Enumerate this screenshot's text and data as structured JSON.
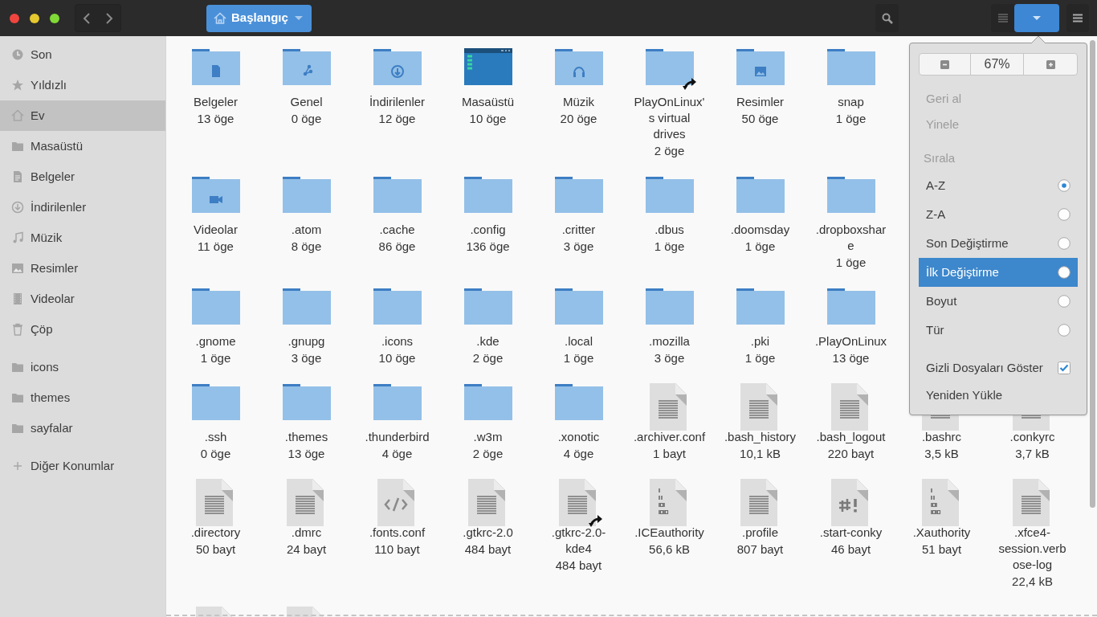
{
  "header": {
    "location": "Başlangıç"
  },
  "sidebar": {
    "sections": [
      [
        {
          "label": "Son",
          "kind": "clock",
          "selected": false
        },
        {
          "label": "Yıldızlı",
          "kind": "star",
          "selected": false
        },
        {
          "label": "Ev",
          "kind": "home",
          "selected": true
        },
        {
          "label": "Masaüstü",
          "kind": "folder",
          "selected": false
        },
        {
          "label": "Belgeler",
          "kind": "doc",
          "selected": false
        },
        {
          "label": "İndirilenler",
          "kind": "download",
          "selected": false
        },
        {
          "label": "Müzik",
          "kind": "music",
          "selected": false
        },
        {
          "label": "Resimler",
          "kind": "image",
          "selected": false
        },
        {
          "label": "Videolar",
          "kind": "video",
          "selected": false
        },
        {
          "label": "Çöp",
          "kind": "trash",
          "selected": false
        }
      ],
      [
        {
          "label": "icons",
          "kind": "folder",
          "selected": false
        },
        {
          "label": "themes",
          "kind": "folder",
          "selected": false
        },
        {
          "label": "sayfalar",
          "kind": "folder",
          "selected": false
        }
      ],
      [
        {
          "label": "Diğer Konumlar",
          "kind": "plus",
          "selected": false
        }
      ]
    ]
  },
  "files": {
    "rows": [
      [
        {
          "name": "Belgeler",
          "info": "13 öge",
          "kind": "folder-doc",
          "link": false
        },
        {
          "name": "Genel",
          "info": "0 öge",
          "kind": "folder-share",
          "link": false
        },
        {
          "name": "İndirilenler",
          "info": "12 öge",
          "kind": "folder-download",
          "link": false
        },
        {
          "name": "Masaüstü",
          "info": "10 öge",
          "kind": "desktop",
          "link": false
        },
        {
          "name": "Müzik",
          "info": "20 öge",
          "kind": "folder-music",
          "link": false
        },
        {
          "name": "PlayOnLinux's virtual drives",
          "info": "2 öge",
          "kind": "folder",
          "link": true
        },
        {
          "name": "Resimler",
          "info": "50 öge",
          "kind": "folder-image",
          "link": false
        },
        {
          "name": "snap",
          "info": "1 öge",
          "kind": "folder",
          "link": false
        }
      ],
      [
        {
          "name": "Videolar",
          "info": "11 öge",
          "kind": "folder-video",
          "link": false
        },
        {
          "name": ".atom",
          "info": "8 öge",
          "kind": "folder",
          "link": false
        },
        {
          "name": ".cache",
          "info": "86 öge",
          "kind": "folder",
          "link": false
        },
        {
          "name": ".config",
          "info": "136 öge",
          "kind": "folder",
          "link": false
        },
        {
          "name": ".critter",
          "info": "3 öge",
          "kind": "folder",
          "link": false
        },
        {
          "name": ".dbus",
          "info": "1 öge",
          "kind": "folder",
          "link": false
        },
        {
          "name": ".doomsday",
          "info": "1 öge",
          "kind": "folder",
          "link": false
        },
        {
          "name": ".dropboxshare",
          "info": "1 öge",
          "kind": "folder",
          "link": false
        }
      ],
      [
        {
          "name": ".gnome",
          "info": "1 öge",
          "kind": "folder",
          "link": false
        },
        {
          "name": ".gnupg",
          "info": "3 öge",
          "kind": "folder",
          "link": false
        },
        {
          "name": ".icons",
          "info": "10 öge",
          "kind": "folder",
          "link": false
        },
        {
          "name": ".kde",
          "info": "2 öge",
          "kind": "folder",
          "link": false
        },
        {
          "name": ".local",
          "info": "1 öge",
          "kind": "folder",
          "link": false
        },
        {
          "name": ".mozilla",
          "info": "3 öge",
          "kind": "folder",
          "link": false
        },
        {
          "name": ".pki",
          "info": "1 öge",
          "kind": "folder",
          "link": false
        },
        {
          "name": ".PlayOnLinux",
          "info": "13 öge",
          "kind": "folder",
          "link": false
        }
      ],
      [
        {
          "name": ".ssh",
          "info": "0 öge",
          "kind": "folder",
          "link": false
        },
        {
          "name": ".themes",
          "info": "13 öge",
          "kind": "folder",
          "link": false
        },
        {
          "name": ".thunderbird",
          "info": "4 öge",
          "kind": "folder",
          "link": false
        },
        {
          "name": ".w3m",
          "info": "2 öge",
          "kind": "folder",
          "link": false
        },
        {
          "name": ".xonotic",
          "info": "4 öge",
          "kind": "folder",
          "link": false
        },
        {
          "name": ".archiver.conf",
          "info": "1 bayt",
          "kind": "text",
          "link": false
        },
        {
          "name": ".bash_history",
          "info": "10,1 kB",
          "kind": "text",
          "link": false
        },
        {
          "name": ".bash_logout",
          "info": "220 bayt",
          "kind": "text",
          "link": false
        },
        {
          "name": ".bashrc",
          "info": "3,5 kB",
          "kind": "text",
          "link": false
        },
        {
          "name": ".conkyrc",
          "info": "3,7 kB",
          "kind": "text",
          "link": false
        }
      ],
      [
        {
          "name": ".directory",
          "info": "50 bayt",
          "kind": "text",
          "link": false
        },
        {
          "name": ".dmrc",
          "info": "24 bayt",
          "kind": "text",
          "link": false
        },
        {
          "name": ".fonts.conf",
          "info": "110 bayt",
          "kind": "code",
          "link": false
        },
        {
          "name": ".gtkrc-2.0",
          "info": "484 bayt",
          "kind": "text",
          "link": false
        },
        {
          "name": ".gtkrc-2.0-kde4",
          "info": "484 bayt",
          "kind": "text",
          "link": true
        },
        {
          "name": ".ICEauthority",
          "info": "56,6 kB",
          "kind": "binary",
          "link": false
        },
        {
          "name": ".profile",
          "info": "807 bayt",
          "kind": "text",
          "link": false
        },
        {
          "name": ".start-conky",
          "info": "46 bayt",
          "kind": "script",
          "link": false
        },
        {
          "name": ".Xauthority",
          "info": "51 bayt",
          "kind": "binary",
          "link": false
        },
        {
          "name": ".xfce4-session.verbose-log",
          "info": "22,4 kB",
          "kind": "text",
          "link": false
        }
      ],
      [
        {
          "kind": "text"
        },
        {
          "kind": "text"
        }
      ]
    ]
  },
  "menu": {
    "zoom": "67%",
    "history": [
      {
        "label": "Geri al",
        "disabled": true
      },
      {
        "label": "Yinele",
        "disabled": true
      }
    ],
    "sort_heading": "Sırala",
    "sort": [
      {
        "label": "A-Z",
        "selected": true,
        "hover": false
      },
      {
        "label": "Z-A",
        "selected": false,
        "hover": false
      },
      {
        "label": "Son Değiştirme",
        "selected": false,
        "hover": false
      },
      {
        "label": "İlk Değiştirme",
        "selected": false,
        "hover": true
      },
      {
        "label": "Boyut",
        "selected": false,
        "hover": false
      },
      {
        "label": "Tür",
        "selected": false,
        "hover": false
      }
    ],
    "show_hidden": {
      "label": "Gizli Dosyaları Göster",
      "checked": true
    },
    "reload": "Yeniden Yükle"
  }
}
